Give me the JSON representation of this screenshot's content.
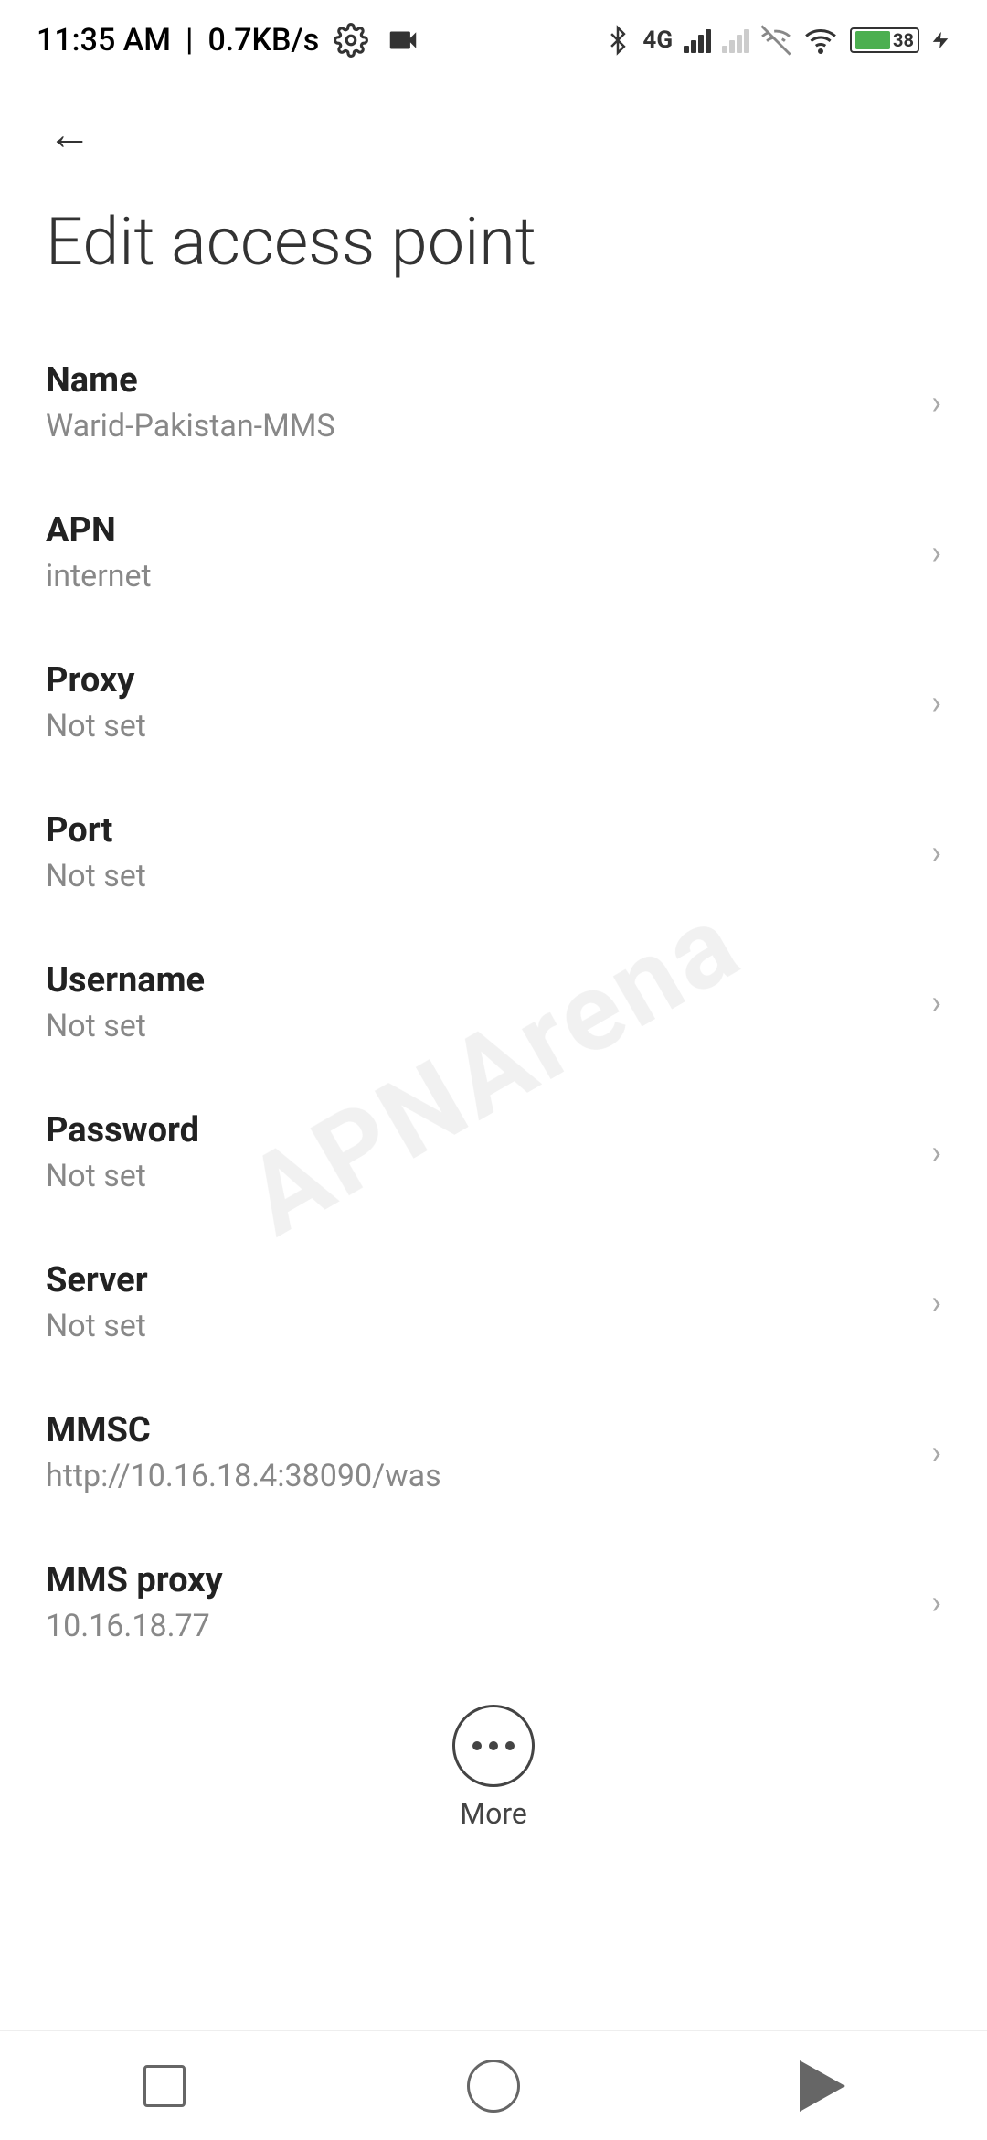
{
  "statusBar": {
    "time": "11:35 AM",
    "speed": "0.7KB/s"
  },
  "toolbar": {
    "backLabel": "←"
  },
  "pageTitle": "Edit access point",
  "settingsItems": [
    {
      "id": "name",
      "label": "Name",
      "value": "Warid-Pakistan-MMS"
    },
    {
      "id": "apn",
      "label": "APN",
      "value": "internet"
    },
    {
      "id": "proxy",
      "label": "Proxy",
      "value": "Not set"
    },
    {
      "id": "port",
      "label": "Port",
      "value": "Not set"
    },
    {
      "id": "username",
      "label": "Username",
      "value": "Not set"
    },
    {
      "id": "password",
      "label": "Password",
      "value": "Not set"
    },
    {
      "id": "server",
      "label": "Server",
      "value": "Not set"
    },
    {
      "id": "mmsc",
      "label": "MMSC",
      "value": "http://10.16.18.4:38090/was"
    },
    {
      "id": "mms-proxy",
      "label": "MMS proxy",
      "value": "10.16.18.77"
    }
  ],
  "moreButton": {
    "label": "More"
  },
  "watermark": "APNArena",
  "navBar": {
    "buttons": [
      "square",
      "circle",
      "triangle"
    ]
  }
}
